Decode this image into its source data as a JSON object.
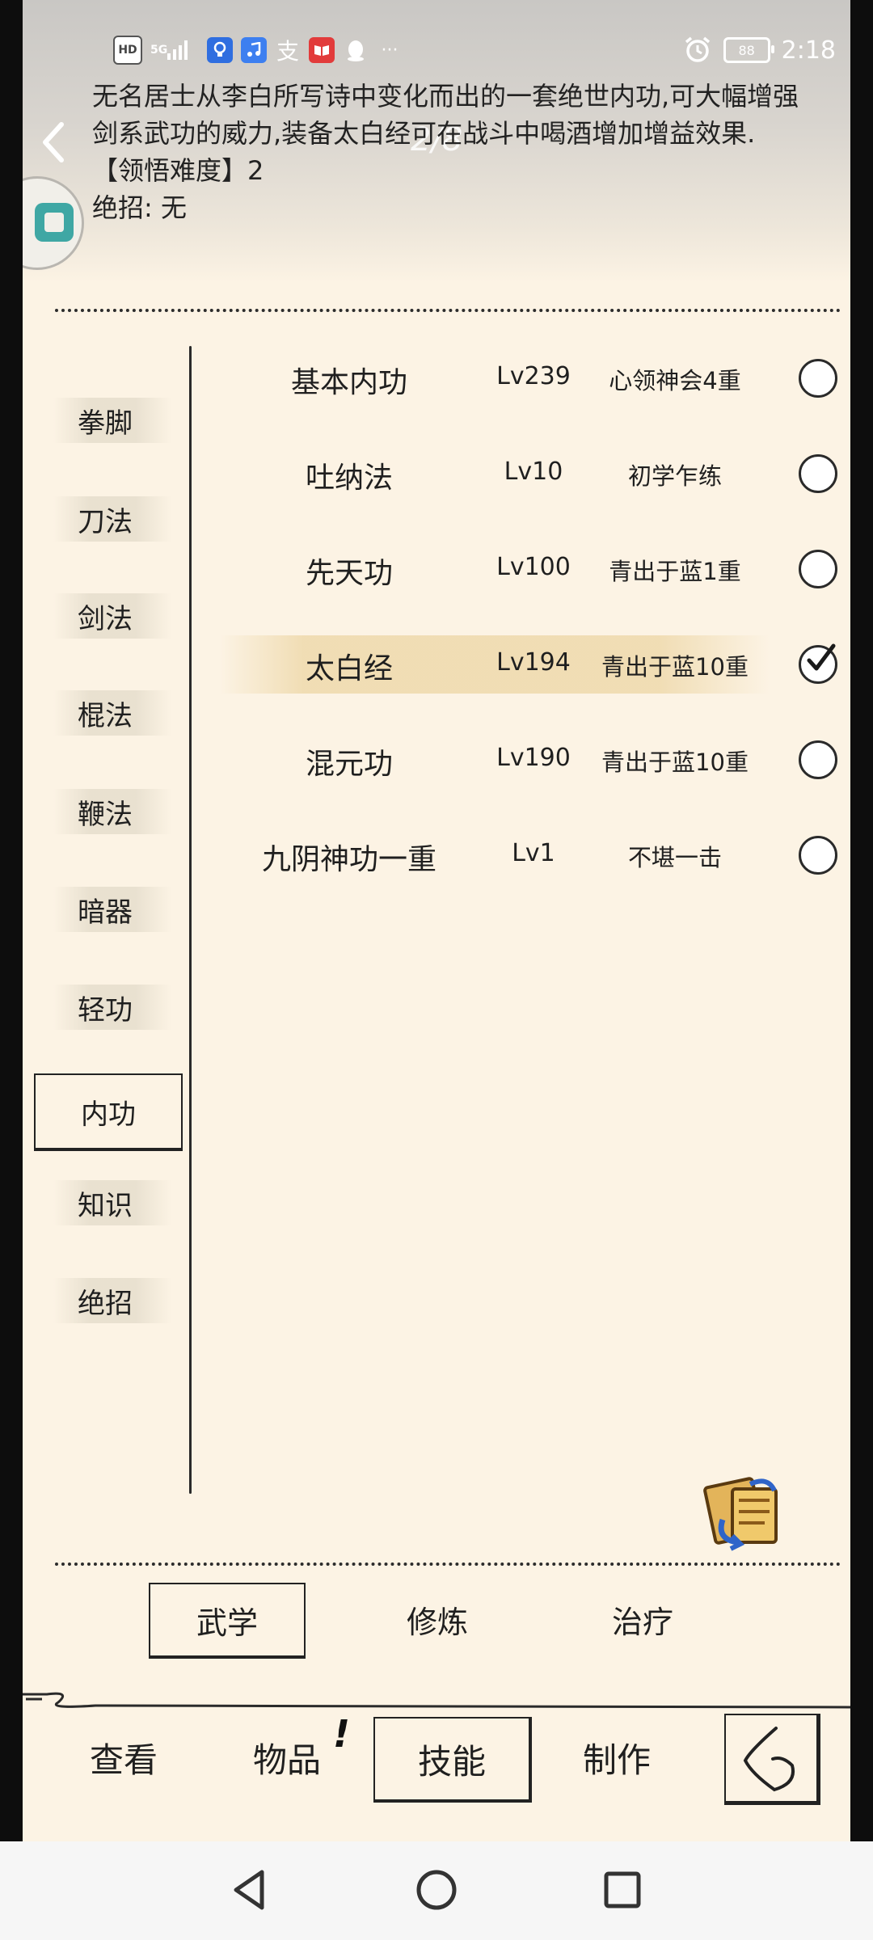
{
  "status_bar": {
    "left_icons": [
      "hd-icon",
      "5g-signal-icon",
      "bulb-app-icon",
      "music-app-icon",
      "alipay-icon",
      "book-app-icon",
      "qq-icon",
      "more-icon"
    ],
    "hd": "HD",
    "net": "5G",
    "alipay": "支",
    "more": "···",
    "battery": "88",
    "time": "2:18"
  },
  "header": {
    "page_indicator": "2/8",
    "description": "无名居士从李白所写诗中变化而出的一套绝世内功,可大幅增强剑系武功的威力,装备太白经可在战斗中喝酒增加增益效果.",
    "difficulty": "【领悟难度】2",
    "ultimate": "绝招: 无"
  },
  "sidebar": {
    "categories": [
      "拳脚",
      "刀法",
      "剑法",
      "棍法",
      "鞭法",
      "暗器",
      "轻功",
      "内功",
      "知识",
      "绝招"
    ],
    "active": "内功"
  },
  "skills": [
    {
      "name": "基本内功",
      "level": "Lv239",
      "rank": "心领神会4重",
      "equipped": false
    },
    {
      "name": "吐纳法",
      "level": "Lv10",
      "rank": "初学乍练",
      "equipped": false
    },
    {
      "name": "先天功",
      "level": "Lv100",
      "rank": "青出于蓝1重",
      "equipped": false
    },
    {
      "name": "太白经",
      "level": "Lv194",
      "rank": "青出于蓝10重",
      "equipped": true
    },
    {
      "name": "混元功",
      "level": "Lv190",
      "rank": "青出于蓝10重",
      "equipped": false
    },
    {
      "name": "九阴神功一重",
      "level": "Lv1",
      "rank": "不堪一击",
      "equipped": false
    }
  ],
  "tabs": {
    "items": [
      "武学",
      "修炼",
      "治疗"
    ],
    "active": "武学"
  },
  "bottom_nav": {
    "items": [
      "查看",
      "物品",
      "技能",
      "制作"
    ],
    "active": "技能",
    "badge": "!"
  },
  "colors": {
    "background": "#fcf3e4",
    "ink": "#1f1f1f",
    "highlight": "#f0dcb2"
  }
}
